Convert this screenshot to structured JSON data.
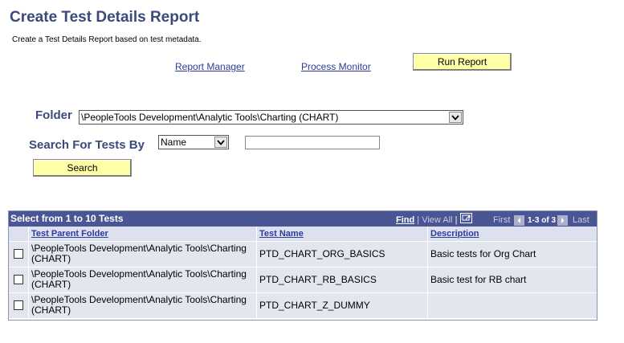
{
  "page": {
    "title": "Create Test Details Report",
    "description": "Create a Test Details Report based on test metadata."
  },
  "links": {
    "report_manager": "Report Manager",
    "process_monitor": "Process Monitor"
  },
  "buttons": {
    "run_report": "Run Report",
    "search": "Search"
  },
  "folder": {
    "label": "Folder",
    "selected": "\\PeopleTools Development\\Analytic Tools\\Charting (CHART)"
  },
  "search": {
    "label": "Search For Tests By",
    "by_selected": "Name",
    "value": ""
  },
  "grid": {
    "title": "Select from 1 to 10 Tests",
    "nav": {
      "find": "Find",
      "separator1": "|",
      "view_all": "View All",
      "separator2": "|",
      "first": "First",
      "range": "1-3 of 3",
      "last": "Last"
    },
    "columns": [
      "Test Parent Folder",
      "Test Name",
      "Description"
    ],
    "rows": [
      {
        "folder_line1": "\\PeopleTools Development\\Analytic Tools\\Charting",
        "folder_line2": "(CHART)",
        "name": "PTD_CHART_ORG_BASICS",
        "description": "Basic tests for Org Chart"
      },
      {
        "folder_line1": "\\PeopleTools Development\\Analytic Tools\\Charting",
        "folder_line2": "(CHART)",
        "name": "PTD_CHART_RB_BASICS",
        "description": "Basic test for RB chart"
      },
      {
        "folder_line1": "\\PeopleTools Development\\Analytic Tools\\Charting",
        "folder_line2": "(CHART)",
        "name": "PTD_CHART_Z_DUMMY",
        "description": ""
      }
    ]
  },
  "colors": {
    "title": "#3c4a7a",
    "link": "#2d3b99",
    "button": "#ffffa8",
    "grid_header": "#4a5593",
    "row_bg": "#e4e6ef"
  }
}
